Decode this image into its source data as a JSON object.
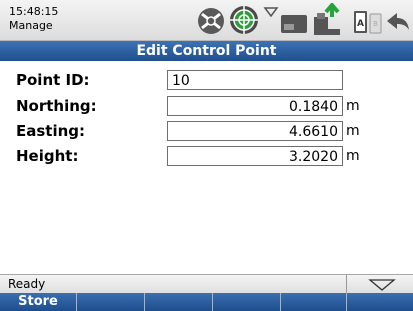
{
  "statusbar": {
    "time": "15:48:15",
    "mode": "Manage",
    "icons": [
      "satellite-icon",
      "gnss-target-icon",
      "radio-icon",
      "controller-icon",
      "usb-transfer-icon",
      "battery-icon",
      "back-arrow-icon"
    ]
  },
  "title": "Edit Control Point",
  "form": {
    "point_id_label": "Point ID:",
    "point_id_value": "10",
    "northing_label": "Northing:",
    "northing_value": "0.1840",
    "northing_unit": "m",
    "easting_label": "Easting:",
    "easting_value": "4.6610",
    "easting_unit": "m",
    "height_label": "Height:",
    "height_value": "3.2020",
    "height_unit": "m"
  },
  "status_text": "Ready",
  "softkeys": [
    "Store",
    "",
    "",
    "",
    "",
    ""
  ]
}
